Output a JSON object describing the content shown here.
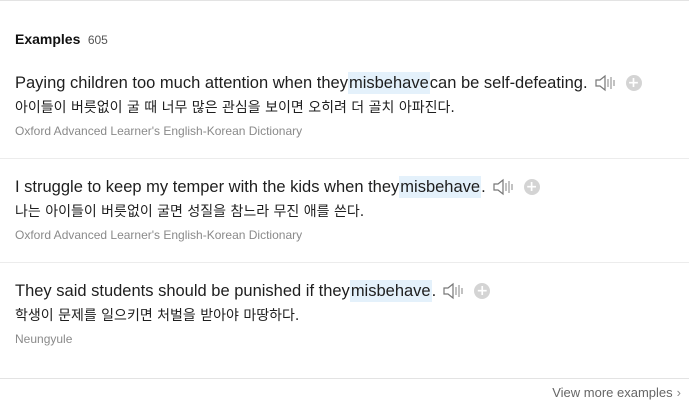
{
  "header": {
    "title": "Examples",
    "count": "605"
  },
  "examples": [
    {
      "before": "Paying children too much attention when they ",
      "highlight": "misbehave",
      "after": " can be self-defeating.",
      "translation": "아이들이 버릇없이 굴 때 너무 많은 관심을 보이면 오히려 더 골치 아파진다.",
      "source": "Oxford Advanced Learner's English-Korean Dictionary"
    },
    {
      "before": "I struggle to keep my temper with the kids when they ",
      "highlight": "misbehave",
      "after": ".",
      "translation": "나는 아이들이 버릇없이 굴면 성질을 참느라 무진 애를 쓴다.",
      "source": "Oxford Advanced Learner's English-Korean Dictionary"
    },
    {
      "before": "They said students should be punished if they ",
      "highlight": "misbehave",
      "after": ".",
      "translation": "학생이 문제를 일으키면 처벌을 받아야 마땅하다.",
      "source": "Neungyule"
    }
  ],
  "footer": {
    "more_label": "View more examples"
  },
  "icons": {
    "speaker": "speaker-icon",
    "add": "plus-circle-icon",
    "chevron": "chevron-right-icon"
  },
  "colors": {
    "highlight_bg": "#e4f1fb",
    "source_text": "#8a8a8a",
    "icon_gray": "#d4d4d4"
  }
}
